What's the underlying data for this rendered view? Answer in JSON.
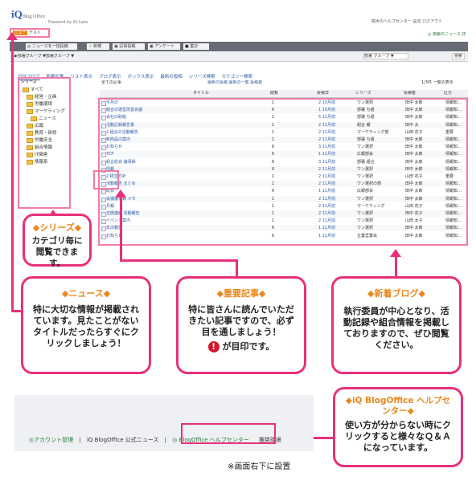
{
  "app": {
    "logo_main": "iQ",
    "logo_sub": "Blog Office",
    "powered": "Powered by iQ-Labs",
    "header_links": "樹木のヘルプセンター 設定 ログアウト",
    "header_right": "◎ 検索のニュース 詳",
    "news_badge": "ニュース",
    "news_text": "テスト",
    "toolbar": [
      "◎ ニュースを一括投稿",
      "☆ 新規",
      "▣ 記事投稿",
      "▣ アンケート",
      "■ 集計"
    ],
    "subbar_left": "▶部署グループ ▼部署グループ ▼",
    "subbar_select": "部署 グループ ▼",
    "subbar_btn": "検索",
    "tabs": [
      "日付ブログ",
      "新着記事",
      "リスト表示",
      "ブログ表示",
      "ボックス表示",
      "最新の投稿",
      "シリーズ検索",
      "カテゴリー検索"
    ],
    "sidebar_title": "シリーズ",
    "sidebar_items": [
      "すべて",
      "経営・企画",
      "労働環境",
      "マーケティング",
      "ニュース",
      "広報",
      "教育・研修",
      "労働安全",
      "組合情報",
      "IT関連",
      "情報系"
    ],
    "table_caption": "全ての記事",
    "table_head_center": "最新の投稿  最新の一覧  投稿者",
    "table_head_right": "1/3件  一覧の表示",
    "columns": [
      "タイトル",
      "閲覧",
      "投稿日",
      "シリーズ",
      "投稿者",
      "区分"
    ],
    "rows": [
      [
        "今月の",
        "1",
        "2 10月前",
        "ワン選択",
        "田中 太郎",
        "情報知…"
      ],
      [
        "組合の運営改善会議",
        "6",
        "1 10月前",
        "部署 ち組",
        "田中 太郎",
        "情報知…"
      ],
      [
        "会社の取組",
        "1",
        "5 11月前",
        "部署 ち組",
        "田中 太郎",
        "情報知…"
      ],
      [
        "活動記録報告書",
        "1",
        "2 11月前",
        "組合 報",
        "田中 太",
        "情報知…"
      ],
      [
        "2 組合の活動報告",
        "1",
        "2 11月前",
        "マーケティング部",
        "山田 花子",
        "重要"
      ],
      [
        "新商品の案内",
        "1",
        "2 11月前",
        "部署 ち組",
        "田中 太郎",
        "情報知…"
      ],
      [
        "お知らせ",
        "6",
        "3 11月前",
        "ワン選択",
        "田中 太郎",
        "情報知…"
      ],
      [
        "TCP",
        "6",
        "1 11月前",
        "広報部会",
        "田中 太郎",
        "情報知…"
      ],
      [
        "組合総会 議事録",
        "6",
        "3 11月前",
        "部署 組合",
        "田中 太郎",
        "情報知…"
      ],
      [
        "情報",
        "6",
        "2 11月前",
        "ワン選択",
        "田中 太郎",
        "情報知…"
      ],
      [
        "2 経営方針",
        "1",
        "2 11月前",
        "ワン選択",
        "山田 花子",
        "重要"
      ],
      [
        "活動報告 まとめ",
        "1",
        "2 11月前",
        "ワン選択の部",
        "田中 太郎",
        "情報知…"
      ],
      [
        "総会",
        "6",
        "1 11月前",
        "広報部会",
        "田中 太郎",
        "情報知…"
      ],
      [
        "会議議事録 メモ",
        "1",
        "2 11月前",
        "ワン選択",
        "田中 太郎",
        "情報知…"
      ],
      [
        "月報",
        "1",
        "2 11月前",
        "マーケティング",
        "山田 花子",
        "情報知…"
      ],
      [
        "定期連絡 活動報告",
        "1",
        "2 11月前",
        "ワン選択",
        "田中 花子",
        "情報知…"
      ],
      [
        "イベント案内",
        "1",
        "2 11月前",
        "ワン選択",
        "山田 太子",
        "情報知…"
      ],
      [
        "年次報告",
        "6",
        "1 11月前",
        "ワン選択",
        "田中 太郎",
        "情報知…"
      ],
      [
        "お知らせ",
        "6",
        "1 11月前",
        "企業営業会",
        "田中 太郎",
        "情報知…"
      ]
    ]
  },
  "callouts": {
    "series": {
      "title": "◆シリーズ◆",
      "text": "カテゴリ毎に閲覧できます。"
    },
    "news": {
      "title": "◆ニュース◆",
      "text": "特に大切な情報が掲載されています。見たことがないタイトルだったらすぐにクリックしましょう！"
    },
    "important": {
      "title": "◆重要記事◆",
      "text": "特に皆さんに読んでいただきたい記事ですので、必ず目を通しましょう！",
      "mark_text": "が目印です。"
    },
    "newblog": {
      "title": "◆新着ブログ◆",
      "text": "執行委員が中心となり、活動記録や組合情報を掲載しておりますので、ぜひ閲覧ください。"
    },
    "help": {
      "title": "◆iQ BlogOffice ヘルプセンター◆",
      "text": "使い方が分からない時にクリックすると様々なＱ＆Ａになっています。"
    }
  },
  "footer": {
    "links": [
      "◎アカウント管理",
      "iQ BlogOffice 公式ニュース",
      "◎ BlogOffice ヘルプセンター",
      "推奨環境"
    ],
    "note": "※画面右下に設置"
  },
  "colors": {
    "accent": "#e8317a",
    "orange": "#e8881e",
    "toolbar": "#666b75"
  }
}
